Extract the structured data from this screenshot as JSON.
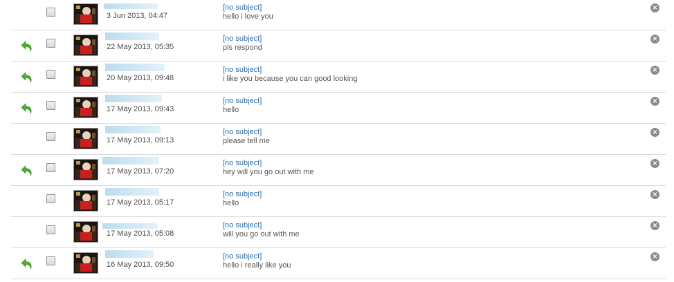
{
  "colors": {
    "subject_link": "#2a6fa8",
    "reply_arrow": "#4caf2e",
    "separator": "#d9d9d9"
  },
  "icons": {
    "reply": "reply-arrow-icon",
    "delete": "close-circle-icon",
    "avatar": "profile-photo"
  },
  "messages": [
    {
      "replied": false,
      "date": "3 Jun 2013, 04:47",
      "subject": "[no subject]",
      "snippet": "hello i love you"
    },
    {
      "replied": true,
      "date": "22 May 2013, 05:35",
      "subject": "[no subject]",
      "snippet": "pls respond"
    },
    {
      "replied": true,
      "date": "20 May 2013, 09:48",
      "subject": "[no subject]",
      "snippet": "i like you because you can good looking"
    },
    {
      "replied": true,
      "date": "17 May 2013, 09:43",
      "subject": "[no subject]",
      "snippet": "hello"
    },
    {
      "replied": false,
      "date": "17 May 2013, 09:13",
      "subject": "[no subject]",
      "snippet": "please tell me"
    },
    {
      "replied": true,
      "date": "17 May 2013, 07:20",
      "subject": "[no subject]",
      "snippet": "hey will you go out with me"
    },
    {
      "replied": false,
      "date": "17 May 2013, 05:17",
      "subject": "[no subject]",
      "snippet": "hello"
    },
    {
      "replied": false,
      "date": "17 May 2013, 05:08",
      "subject": "[no subject]",
      "snippet": "will you go out with me"
    },
    {
      "replied": true,
      "date": "16 May 2013, 09:50",
      "subject": "[no subject]",
      "snippet": "hello i really like you"
    }
  ],
  "delete_glyph": "×"
}
